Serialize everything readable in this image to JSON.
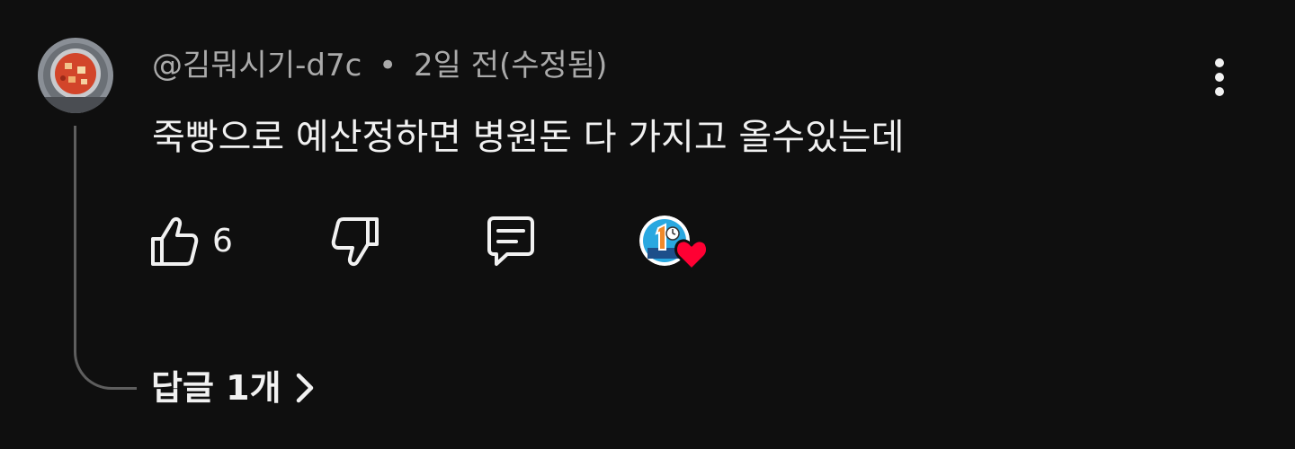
{
  "comment": {
    "author": "@김뭐시기-d7c",
    "separator": "•",
    "timestamp": "2일 전(수정됨)",
    "text": "죽빵으로 예산정하면 병원돈 다 가지고 올수있는데",
    "like_count": "6",
    "replies_label": "답글 1개"
  },
  "icons": {
    "avatar": "food-pot-avatar",
    "more": "vertical-dots-icon",
    "like": "thumbs-up-icon",
    "dislike": "thumbs-down-icon",
    "reply": "comment-icon",
    "creator_heart": "creator-heart-badge",
    "chevron": "chevron-right-icon"
  },
  "colors": {
    "background": "#0f0f0f",
    "text_primary": "#f1f1f1",
    "text_secondary": "#aaaaaa",
    "thread_line": "#5e5e5e",
    "heart": "#ff0033"
  }
}
